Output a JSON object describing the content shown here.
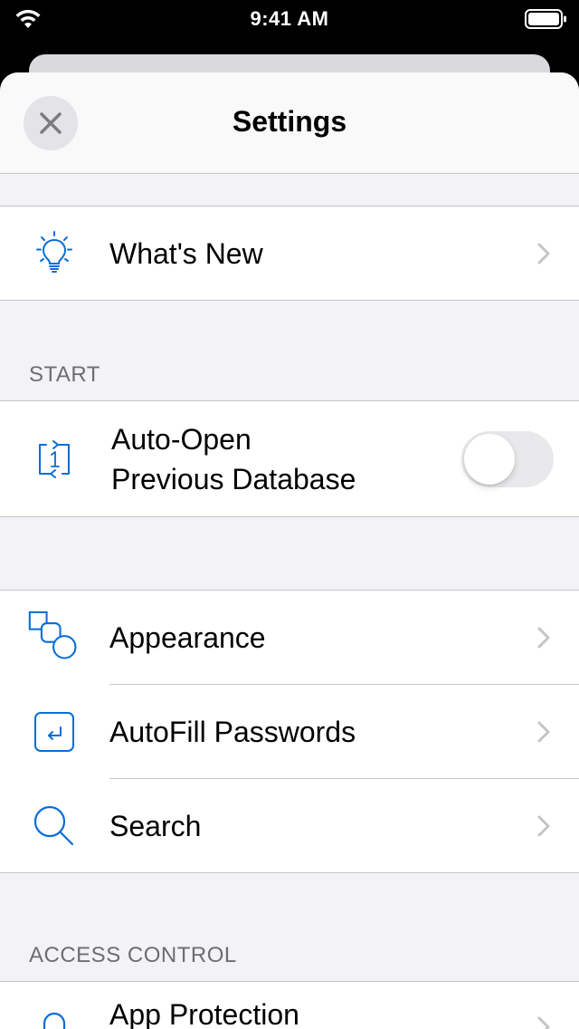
{
  "status_bar": {
    "time": "9:41 AM",
    "icons": [
      "wifi-icon",
      "battery-icon"
    ]
  },
  "nav": {
    "title": "Settings",
    "close_icon": "close-icon"
  },
  "whats_new": {
    "label": "What's New",
    "icon": "lightbulb-icon"
  },
  "start_section": {
    "header": "START",
    "auto_open": {
      "label_line1": "Auto-Open",
      "label_line2": "Previous Database",
      "icon": "auto-open-icon",
      "toggle_on": false
    }
  },
  "general_items": [
    {
      "label": "Appearance",
      "icon": "shapes-icon"
    },
    {
      "label": "AutoFill Passwords",
      "icon": "autofill-icon"
    },
    {
      "label": "Search",
      "icon": "search-icon"
    }
  ],
  "access_section": {
    "header": "ACCESS CONTROL",
    "items": [
      {
        "label": "App Protection",
        "icon": "lock-icon"
      }
    ]
  },
  "colors": {
    "accent": "#0a6cd6",
    "chevron": "#c4c4c7",
    "background": "#f2f2f7"
  }
}
